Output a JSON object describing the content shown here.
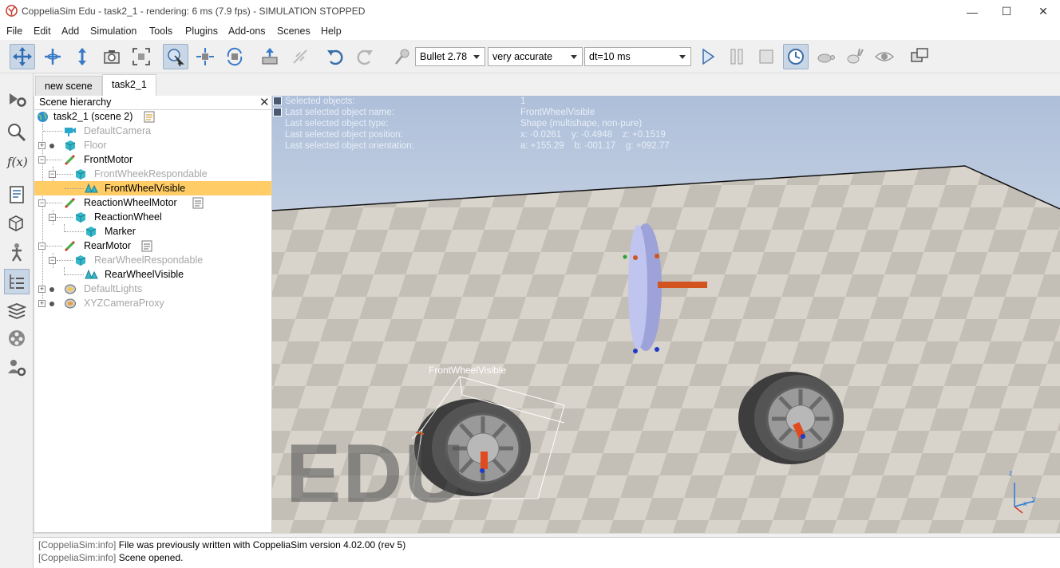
{
  "window": {
    "title": "CoppeliaSim Edu - task2_1 - rendering: 6 ms (7.9 fps) - SIMULATION STOPPED",
    "buttons": {
      "minimize": "—",
      "maximize": "☐",
      "close": "✕"
    }
  },
  "menu": [
    "File",
    "Edit",
    "Add",
    "Simulation",
    "Tools",
    "Plugins",
    "Add-ons",
    "Scenes",
    "Help"
  ],
  "toolbar": {
    "physics_engine": "Bullet 2.78",
    "accuracy": "very accurate",
    "timestep": "dt=10 ms"
  },
  "tabs": [
    "new scene",
    "task2_1"
  ],
  "hierarchy": {
    "title": "Scene hierarchy",
    "close": "✕",
    "items": [
      {
        "label": "task2_1 (scene 2)"
      },
      {
        "label": "DefaultCamera"
      },
      {
        "label": "Floor"
      },
      {
        "label": "FrontMotor"
      },
      {
        "label": "FrontWheekRespondable"
      },
      {
        "label": "FrontWheelVisible"
      },
      {
        "label": "ReactionWheelMotor"
      },
      {
        "label": "ReactionWheel"
      },
      {
        "label": "Marker"
      },
      {
        "label": "RearMotor"
      },
      {
        "label": "RearWheelRespondable"
      },
      {
        "label": "RearWheelVisible"
      },
      {
        "label": "DefaultLights"
      },
      {
        "label": "XYZCameraProxy"
      }
    ]
  },
  "viewport": {
    "info": {
      "selected_objects_label": "Selected objects:",
      "selected_objects_value": "1",
      "name_label": "Last selected object name:",
      "name_value": "FrontWheelVisible",
      "type_label": "Last selected object type:",
      "type_value": "Shape (multishape, non-pure)",
      "position_label": "Last selected object position:",
      "position_value": "x: -0.0261    y: -0.4948    z: +0.1519",
      "orientation_label": "Last selected object orientation:",
      "orientation_value": "a: +155.29    b: -001.17    g: +092.77"
    },
    "selected_tag": "FrontWheelVisible",
    "watermark": "EDU",
    "axes": {
      "z": "z",
      "x": "x",
      "y": "y"
    }
  },
  "console": {
    "lines": [
      {
        "prefix": "[CoppeliaSim:info]",
        "text": "File was previously written with CoppeliaSim version 4.02.00 (rev 5)"
      },
      {
        "prefix": "[CoppeliaSim:info]",
        "text": "Scene opened."
      }
    ]
  }
}
